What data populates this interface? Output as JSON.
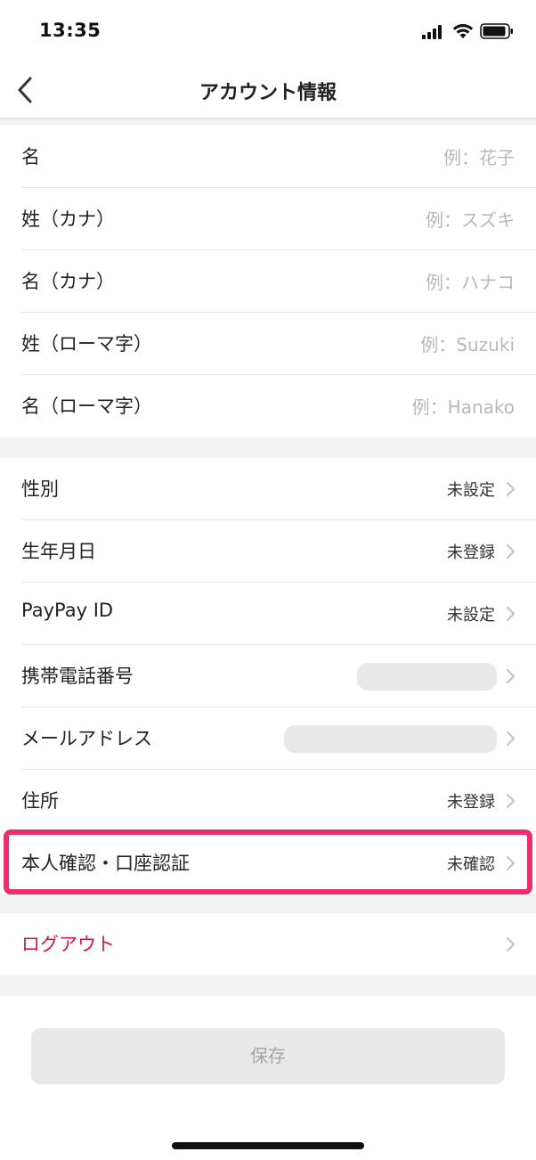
{
  "status_bar": {
    "time": "13:35"
  },
  "nav": {
    "title": "アカウント情報"
  },
  "name_fields": [
    {
      "label": "名",
      "placeholder": "例：花子"
    },
    {
      "label": "姓（カナ）",
      "placeholder": "例：スズキ"
    },
    {
      "label": "名（カナ）",
      "placeholder": "例：ハナコ"
    },
    {
      "label": "姓（ローマ字）",
      "placeholder": "例：Suzuki"
    },
    {
      "label": "名（ローマ字）",
      "placeholder": "例：Hanako"
    }
  ],
  "settings": {
    "gender": {
      "label": "性別",
      "value": "未設定"
    },
    "birthday": {
      "label": "生年月日",
      "value": "未登録"
    },
    "paypay_id": {
      "label": "PayPay ID",
      "value": "未設定"
    },
    "phone": {
      "label": "携帯電話番号"
    },
    "email": {
      "label": "メールアドレス"
    },
    "address": {
      "label": "住所",
      "value": "未登録"
    },
    "identity": {
      "label": "本人確認・口座認証",
      "value": "未確認"
    }
  },
  "logout": {
    "label": "ログアウト"
  },
  "save": {
    "label": "保存"
  },
  "colors": {
    "highlight": "#ee2d6e",
    "logout": "#d6183f"
  }
}
